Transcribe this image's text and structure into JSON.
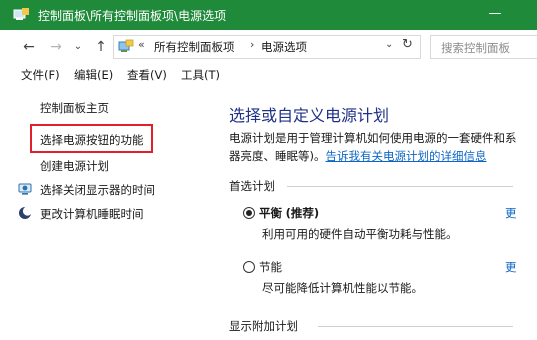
{
  "window": {
    "title": "控制面板\\所有控制面板项\\电源选项",
    "minimize_glyph": "—"
  },
  "address": {
    "overflow": "«",
    "crumb1": "所有控制面板项",
    "separator": "›",
    "crumb2": "电源选项",
    "search_placeholder": "搜索控制面板"
  },
  "menu": {
    "file": "文件(F)",
    "edit": "编辑(E)",
    "view": "查看(V)",
    "tools": "工具(T)"
  },
  "sidebar": {
    "home": "控制面板主页",
    "power_buttons": "选择电源按钮的功能",
    "create_plan": "创建电源计划",
    "display_off": "选择关闭显示器的时间",
    "sleep": "更改计算机睡眠时间"
  },
  "main": {
    "heading": "选择或自定义电源计划",
    "desc_line1": "电源计划是用于管理计算机如何使用电源的一套硬件和系",
    "desc_line2_prefix": "器亮度、睡眠等)。",
    "desc_link": "告诉我有关电源计划的详细信息",
    "preferred_group": "首选计划",
    "plan1_name": "平衡",
    "plan1_tag": "(推荐)",
    "plan1_desc": "利用可用的硬件自动平衡功耗与性能。",
    "plan2_name": "节能",
    "plan2_desc": "尽可能降低计算机性能以节能。",
    "change_link": "更",
    "additional_group": "显示附加计划"
  },
  "colors": {
    "titlebar": "#1f8a3a",
    "heading": "#1e3287",
    "link": "#0d66c6",
    "highlight_box": "#e0202a"
  }
}
